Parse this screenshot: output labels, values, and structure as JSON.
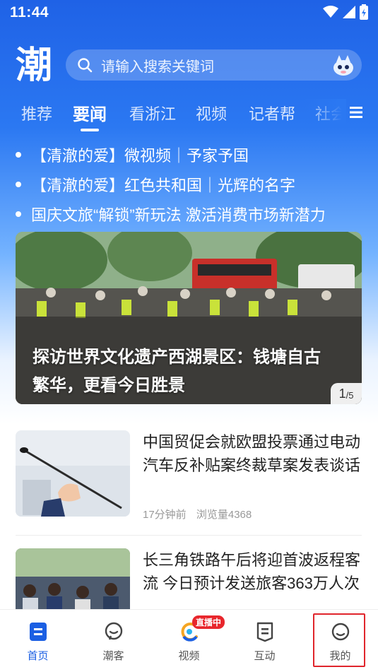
{
  "status_bar": {
    "time": "11:44"
  },
  "header": {
    "logo_text": "潮",
    "search_placeholder": "请输入搜索关键词"
  },
  "tabs": [
    {
      "label": "推荐",
      "active": false
    },
    {
      "label": "要闻",
      "active": true
    },
    {
      "label": "看浙江",
      "active": false
    },
    {
      "label": "视频",
      "active": false
    },
    {
      "label": "记者帮",
      "active": false
    },
    {
      "label": "社会",
      "active": false
    }
  ],
  "headlines": [
    "【清澈的爱】微视频｜予家予国",
    "【清澈的爱】红色共和国｜光辉的名字",
    "国庆文旅“解锁”新玩法 激活消费市场新潜力"
  ],
  "carousel": {
    "caption": "探访世界文化遗产西湖景区：钱塘自古繁华，更看今日胜景",
    "current": "1",
    "total": "/5"
  },
  "news": [
    {
      "title": "中国贸促会就欧盟投票通过电动汽车反补贴案终裁草案发表谈话",
      "time": "17分钟前",
      "views": "浏览量4368"
    },
    {
      "title": "长三角铁路午后将迎首波返程客流 今日预计发送旅客363万人次",
      "time": "",
      "views": ""
    }
  ],
  "bottom_nav": [
    {
      "label": "首页",
      "icon": "home-icon",
      "active": true
    },
    {
      "label": "潮客",
      "icon": "chat-icon",
      "active": false
    },
    {
      "label": "视频",
      "icon": "video-icon",
      "active": false,
      "badge": "直播中"
    },
    {
      "label": "互动",
      "icon": "interact-icon",
      "active": false
    },
    {
      "label": "我的",
      "icon": "profile-icon",
      "active": false
    }
  ],
  "colors": {
    "brand_blue": "#1f62e6",
    "active_nav": "#1b5fe3",
    "live_badge": "#e8262c",
    "highlight_box": "#e0252c"
  }
}
